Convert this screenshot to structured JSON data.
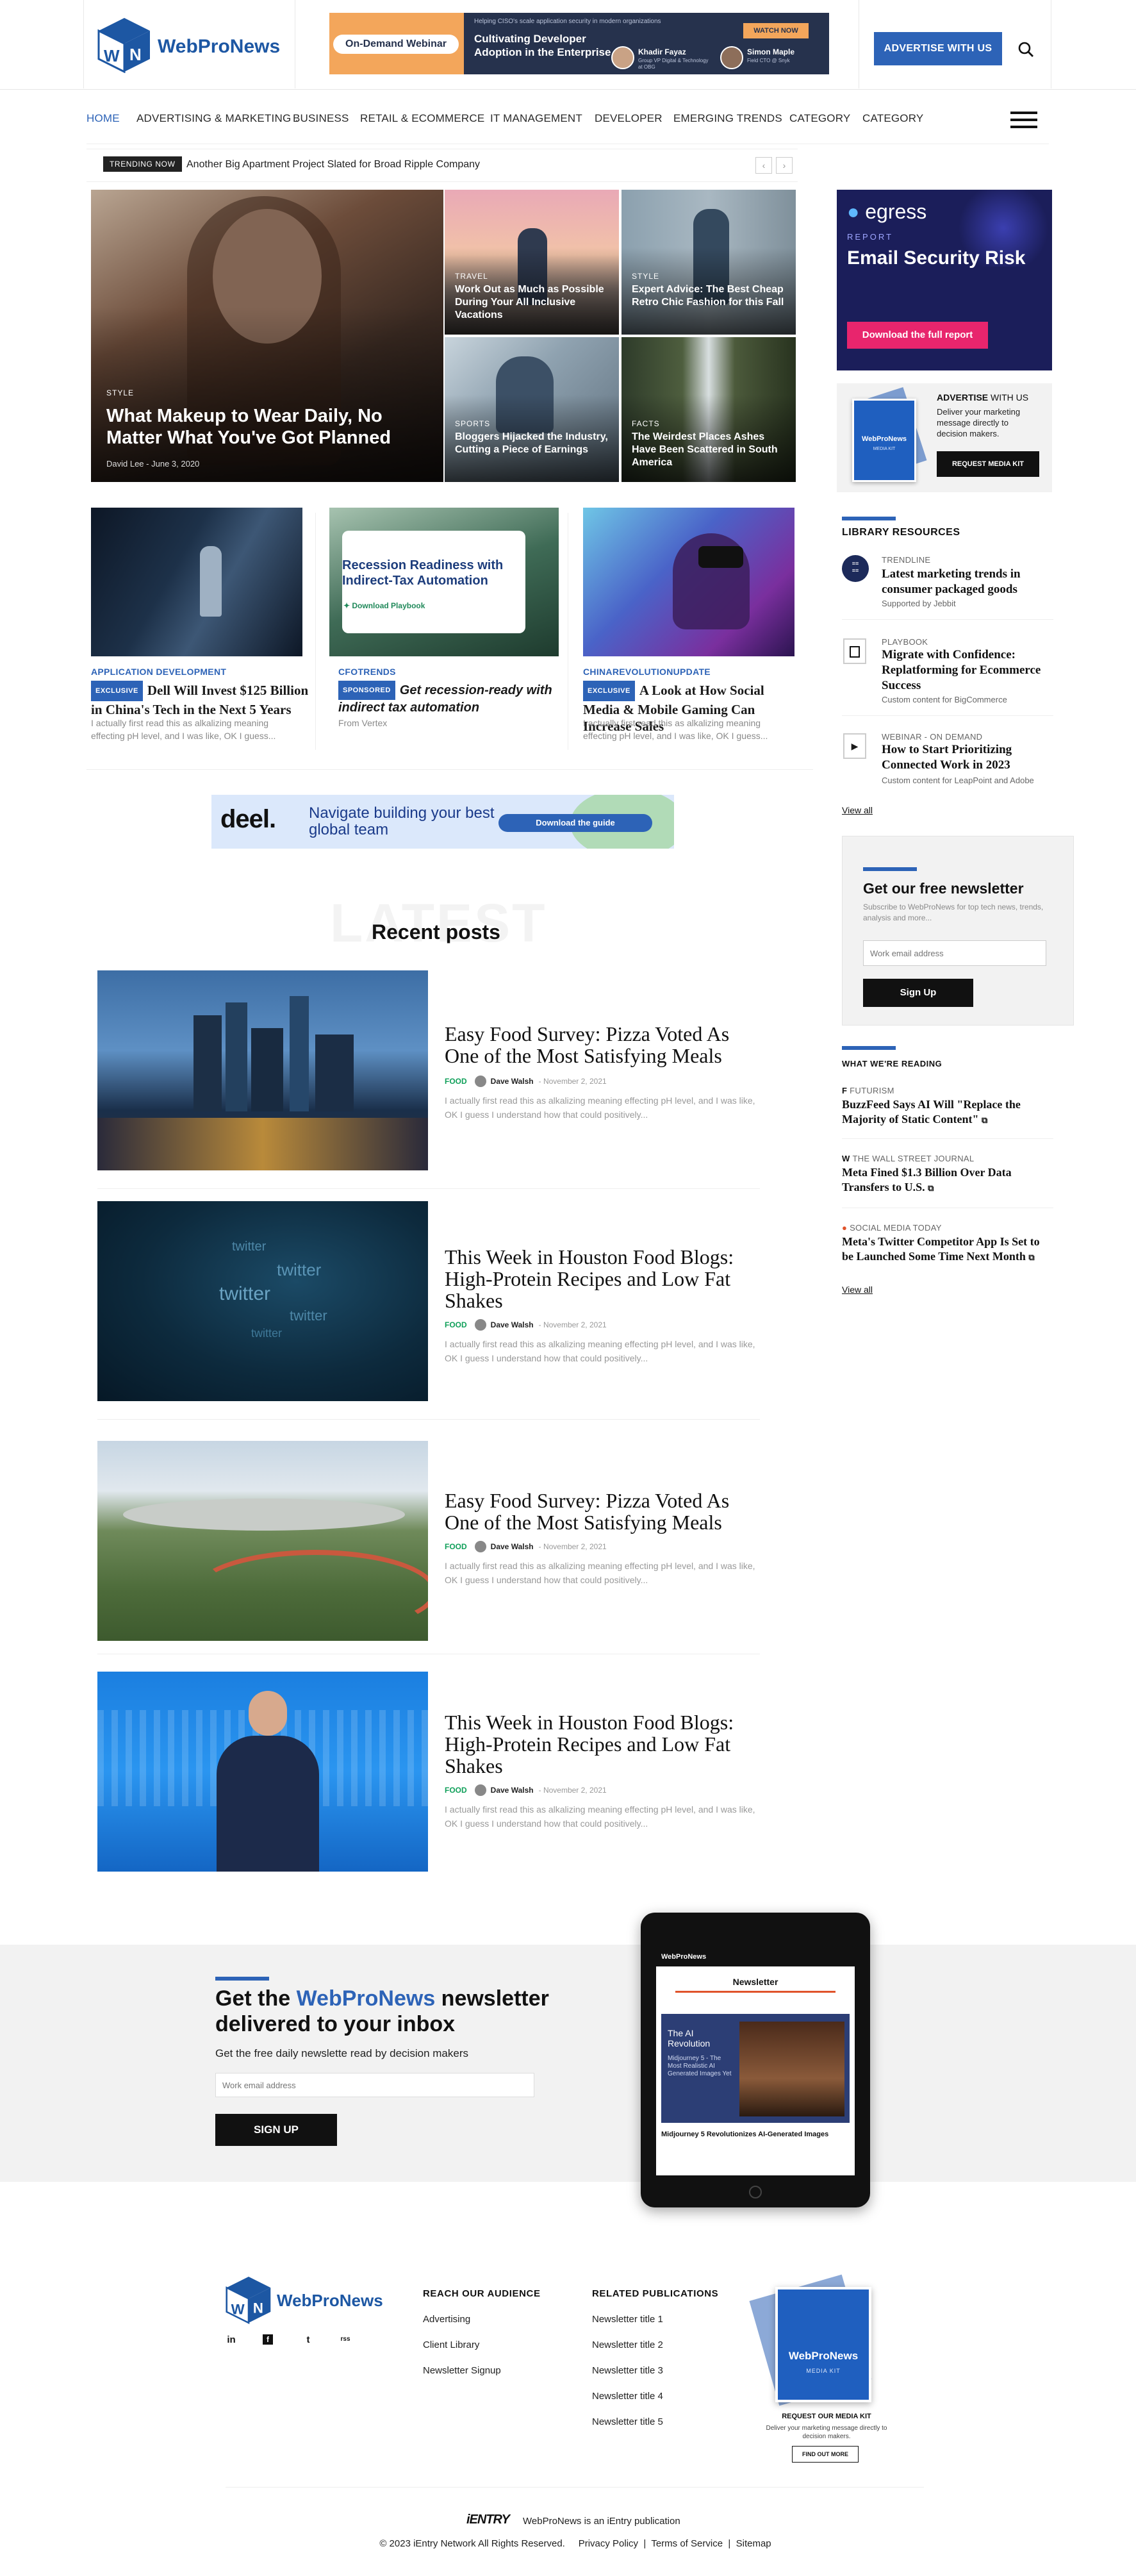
{
  "brand": {
    "name": "WebProNews",
    "accent": "#2d63b7",
    "logo_letters": "WN"
  },
  "header": {
    "advertise_label": "ADVERTISE WITH US",
    "search_icon": "search-icon",
    "banner": {
      "tag": "On-Demand Webinar",
      "kicker": "Helping CISO's scale application security in modern organizations",
      "title": "Cultivating Developer Adoption in the Enterprise",
      "watch_label": "WATCH NOW",
      "speaker1_name": "Khadir Fayaz",
      "speaker1_role": "Group VP Digital & Technology at OBG",
      "speaker2_name": "Simon Maple",
      "speaker2_role": "Field CTO @ Snyk"
    }
  },
  "nav": {
    "items": [
      "HOME",
      "ADVERTISING & MARKETING",
      "BUSINESS",
      "RETAIL & ECOMMERCE",
      "IT MANAGEMENT",
      "DEVELOPER",
      "EMERGING TRENDS",
      "CATEGORY",
      "CATEGORY"
    ],
    "active": "HOME"
  },
  "trending": {
    "label": "TRENDING NOW",
    "text": "Another Big Apartment Project Slated for Broad Ripple Company",
    "prev": "‹",
    "next": "›"
  },
  "hero": {
    "main": {
      "category": "STYLE",
      "title": "What Makeup to Wear Daily, No Matter What You've Got Planned",
      "author": "David Lee",
      "date": "June 3, 2020"
    },
    "tiles": [
      {
        "category": "TRAVEL",
        "title": "Work Out as Much as Possible During Your All Inclusive Vacations"
      },
      {
        "category": "STYLE",
        "title": "Expert Advice: The Best Cheap Retro Chic Fashion for this Fall"
      },
      {
        "category": "SPORTS",
        "title": "Bloggers Hijacked the Industry, Cutting a Piece of Earnings"
      },
      {
        "category": "FACTS",
        "title": "The Weirdest Places Ashes Have Been Scattered in South America"
      }
    ]
  },
  "cards": [
    {
      "category": "APPLICATION DEVELOPMENT",
      "badge": "EXCLUSIVE",
      "title": "Dell Will Invest $125 Billion in China's Tech in the Next 5 Years",
      "excerpt": "I actually first read this as alkalizing meaning effecting pH level, and I was like, OK I guess..."
    },
    {
      "category": "CFOTRENDS",
      "badge": "SPONSORED",
      "title": "Get recession-ready with indirect tax automation",
      "excerpt": "From Vertex",
      "ad_title": "Recession Readiness with Indirect-Tax Automation",
      "ad_link": "Download Playbook"
    },
    {
      "category": "CHINAREVOLUTIONUPDATE",
      "badge": "EXCLUSIVE",
      "title": "A Look at How Social Media & Mobile Gaming Can Increase Sales",
      "excerpt": "I actually first read this as alkalizing meaning effecting pH level, and I was like, OK I guess..."
    }
  ],
  "mid_banner": {
    "logo": "deel.",
    "text": "Navigate building your best global team",
    "cta": "Download the guide"
  },
  "recent": {
    "watermark": "LATEST",
    "heading": "Recent posts",
    "posts": [
      {
        "title": "Easy Food Survey: Pizza Voted As One of the Most Satisfying Meals",
        "category": "FOOD",
        "author": "Dave Walsh",
        "date": "November 2, 2021",
        "excerpt": "I actually first read this as alkalizing meaning effecting pH level, and I was like, OK I guess I understand how that could positively..."
      },
      {
        "title": "This Week in Houston Food Blogs: High-Protein Recipes and Low Fat Shakes",
        "category": "FOOD",
        "author": "Dave Walsh",
        "date": "November 2, 2021",
        "excerpt": "I actually first read this as alkalizing meaning effecting pH level, and I was like, OK I guess I understand how that could positively..."
      },
      {
        "title": "Easy Food Survey: Pizza Voted As One of the Most Satisfying Meals",
        "category": "FOOD",
        "author": "Dave Walsh",
        "date": "November 2, 2021",
        "excerpt": "I actually first read this as alkalizing meaning effecting pH level, and I was like, OK I guess I understand how that could positively..."
      },
      {
        "title": "This Week in Houston Food Blogs: High-Protein Recipes and Low Fat Shakes",
        "category": "FOOD",
        "author": "Dave Walsh",
        "date": "November 2, 2021",
        "excerpt": "I actually first read this as alkalizing meaning effecting pH level, and I was like, OK I guess I understand how that could positively..."
      }
    ],
    "twitter_words": [
      "twitter",
      "twitter",
      "twitter",
      "twitter",
      "twitter"
    ]
  },
  "sidebar": {
    "egress": {
      "logo": "egress",
      "kicker": "REPORT",
      "title": "Email Security Risk",
      "cta": "Download the full report"
    },
    "advertise": {
      "title_bold": "ADVERTISE",
      "title_rest": " WITH US",
      "text": "Deliver your marketing message directly to decision makers.",
      "cta": "REQUEST MEDIA KIT",
      "kit_label": "MEDIA KIT"
    },
    "library": {
      "heading": "LIBRARY RESOURCES",
      "items": [
        {
          "type": "TRENDLINE",
          "title": "Latest marketing trends in consumer packaged goods",
          "sub": "Supported by Jebbit"
        },
        {
          "type": "PLAYBOOK",
          "title": "Migrate with Confidence: Replatforming for Ecommerce Success",
          "sub": "Custom content for BigCommerce"
        },
        {
          "type": "WEBINAR - ON DEMAND",
          "title": "How to Start Prioritizing Connected Work in 2023",
          "sub": "Custom content for LeapPoint and Adobe"
        }
      ],
      "view_all": "View all"
    },
    "newsletter": {
      "title": "Get our free newsletter",
      "text": "Subscribe to WebProNews for top tech news, trends, analysis and more...",
      "placeholder": "Work email address",
      "cta": "Sign Up"
    },
    "reading": {
      "heading": "WHAT WE'RE READING",
      "items": [
        {
          "source": "FUTURISM",
          "title": "BuzzFeed Says AI Will \"Replace the Majority of Static Content\""
        },
        {
          "source": "THE WALL STREET JOURNAL",
          "title": "Meta Fined $1.3 Billion Over Data Transfers to U.S."
        },
        {
          "source": "SOCIAL MEDIA TODAY",
          "title": "Meta's Twitter Competitor App Is Set to be Launched Some Time Next Month"
        }
      ],
      "view_all": "View all"
    }
  },
  "newsletter_band": {
    "title_pre": "Get the ",
    "title_brand": "WebProNews",
    "title_post": " newsletter delivered to your inbox",
    "subtitle": "Get the free daily newslette read by decision makers",
    "placeholder": "Work email address",
    "cta": "SIGN UP",
    "tablet": {
      "brand": "WebProNews",
      "label": "Newsletter",
      "story_kicker": "The AI Revolution",
      "story_title": "Midjourney 5 - The Most Realistic AI Generated Images Yet",
      "headline": "Midjourney 5 Revolutionizes AI-Generated Images"
    }
  },
  "footer": {
    "social": [
      "in",
      "f",
      "t",
      "rss"
    ],
    "reach": {
      "heading": "REACH OUR AUDIENCE",
      "links": [
        "Advertising",
        "Client Library",
        "Newsletter Signup"
      ]
    },
    "related": {
      "heading": "RELATED PUBLICATIONS",
      "links": [
        "Newsletter title 1",
        "Newsletter title 2",
        "Newsletter title 3",
        "Newsletter title 4",
        "Newsletter title 5"
      ]
    },
    "media_kit": {
      "brand": "WebProNews",
      "label": "MEDIA KIT",
      "title": "REQUEST OUR MEDIA KIT",
      "text": "Deliver your marketing message directly to decision makers.",
      "cta": "FIND OUT MORE"
    },
    "ientry": {
      "logo": "iENTRY",
      "text": "WebProNews is an iEntry publication"
    },
    "copyright": "© 2023 iEntry Network All Rights Reserved.",
    "legal": [
      "Privacy Policy",
      "Terms of Service",
      "Sitemap"
    ]
  }
}
